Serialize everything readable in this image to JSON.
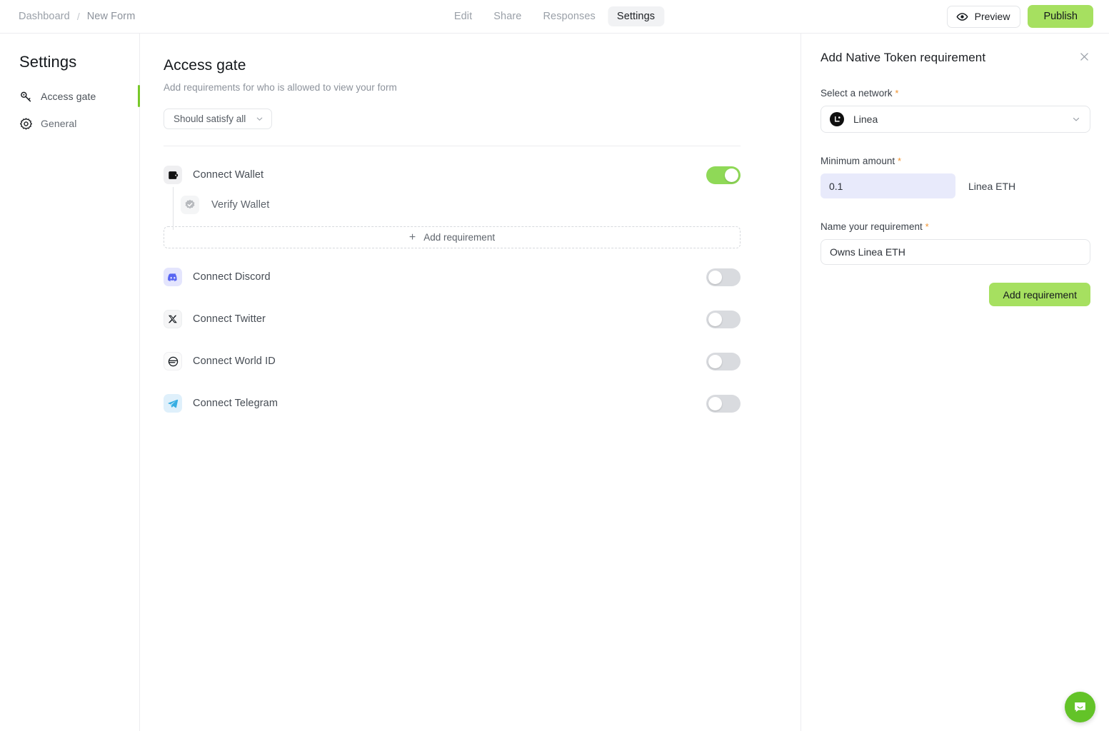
{
  "topbar": {
    "breadcrumb": {
      "root": "Dashboard",
      "separator": "/",
      "current": "New Form"
    },
    "tabs": [
      {
        "label": "Edit",
        "active": false
      },
      {
        "label": "Share",
        "active": false
      },
      {
        "label": "Responses",
        "active": false
      },
      {
        "label": "Settings",
        "active": true
      }
    ],
    "preview_label": "Preview",
    "preview_icon": "eye-icon",
    "publish_label": "Publish",
    "publish_color": "#a6e060"
  },
  "sidebar": {
    "title": "Settings",
    "items": [
      {
        "label": "Access gate",
        "icon": "key-icon",
        "active": true
      },
      {
        "label": "General",
        "icon": "gear-icon",
        "active": false
      }
    ],
    "active_indicator_color": "#78c829"
  },
  "main": {
    "title": "Access gate",
    "subtitle": "Add requirements for who is allowed to view your form",
    "satisfy_select": {
      "value": "Should satisfy all",
      "icon": "chevron-down-icon"
    },
    "requirements": [
      {
        "label": "Connect Wallet",
        "icon": "wallet-icon",
        "icon_bg": "#efeff1",
        "toggle": "on",
        "sub_requirements": [
          {
            "label": "Verify Wallet",
            "icon": "verified-badge-icon"
          }
        ],
        "add_requirement_label": "Add requirement",
        "add_requirement_icon": "plus-icon"
      },
      {
        "label": "Connect Discord",
        "icon": "discord-icon",
        "icon_bg": "#e4e5fd",
        "toggle": "off"
      },
      {
        "label": "Connect Twitter",
        "icon": "x-twitter-icon",
        "icon_bg": "#f4f5f6",
        "toggle": "off"
      },
      {
        "label": "Connect World ID",
        "icon": "world-id-icon",
        "icon_bg": "#fafafa",
        "toggle": "off"
      },
      {
        "label": "Connect Telegram",
        "icon": "telegram-icon",
        "icon_bg": "#dff0fb",
        "toggle": "off"
      }
    ]
  },
  "right_panel": {
    "title": "Add Native Token requirement",
    "close_icon": "close-icon",
    "network_field": {
      "label": "Select a network",
      "required_marker": "*",
      "value": "Linea",
      "icon": "linea-logo-icon",
      "chevron": "chevron-down-icon"
    },
    "amount_field": {
      "label": "Minimum amount",
      "required_marker": "*",
      "value": "0.1",
      "placeholder": "0.1",
      "unit": "Linea ETH"
    },
    "name_field": {
      "label": "Name your requirement",
      "required_marker": "*",
      "value": "Owns Linea ETH",
      "placeholder": "Owns Linea ETH"
    },
    "submit_label": "Add requirement",
    "submit_color": "#a6e060"
  },
  "chat_widget": {
    "icon": "chat-bubble-icon",
    "color": "#63c328"
  }
}
